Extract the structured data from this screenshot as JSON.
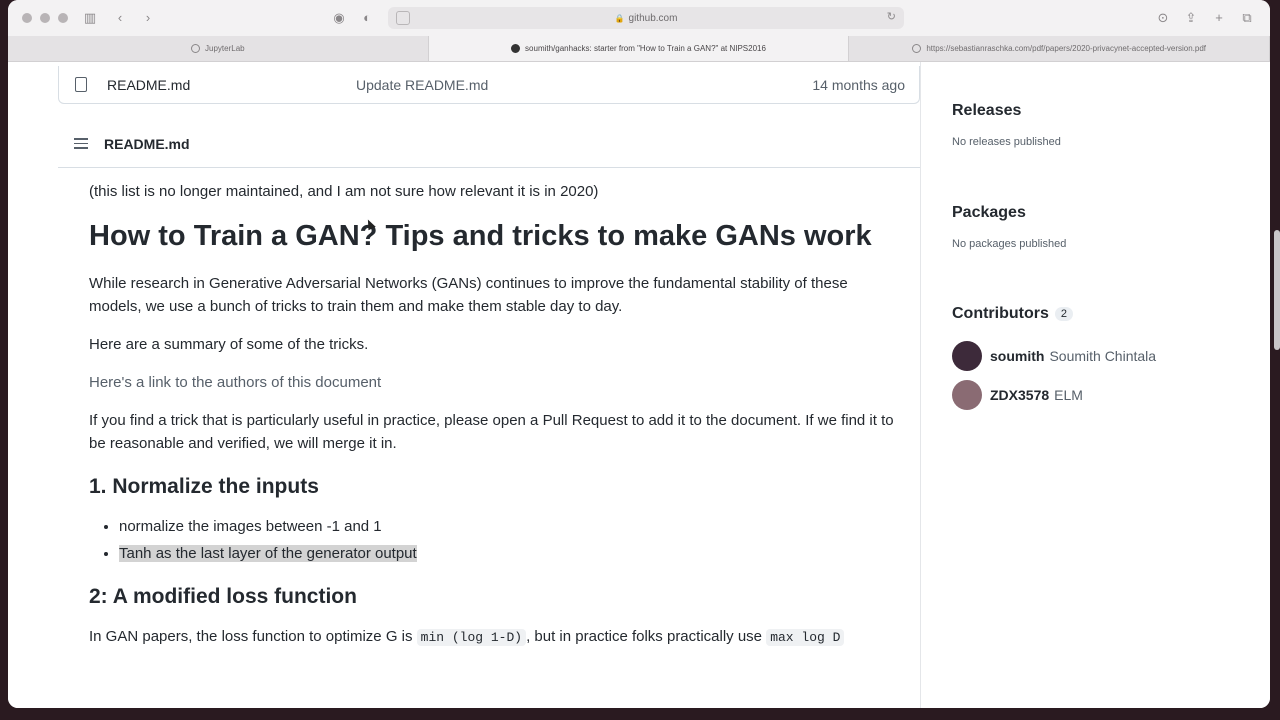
{
  "browser": {
    "url": "github.com",
    "tabs": [
      {
        "label": "JupyterLab"
      },
      {
        "label": "soumith/ganhacks: starter from \"How to Train a GAN?\" at NIPS2016"
      },
      {
        "label": "https://sebastianraschka.com/pdf/papers/2020-privacynet-accepted-version.pdf"
      }
    ]
  },
  "file_row": {
    "name": "README.md",
    "message": "Update README.md",
    "date": "14 months ago"
  },
  "readme": {
    "header": "README.md",
    "note": "(this list is no longer maintained, and I am not sure how relevant it is in 2020)",
    "title": "How to Train a GAN? Tips and tricks to make GANs work",
    "intro": "While research in Generative Adversarial Networks (GANs) continues to improve the fundamental stability of these models, we use a bunch of tricks to train them and make them stable day to day.",
    "summary": "Here are a summary of some of the tricks.",
    "authors_link": "Here's a link to the authors of this document",
    "contribute": "If you find a trick that is particularly useful in practice, please open a Pull Request to add it to the document. If we find it to be reasonable and verified, we will merge it in.",
    "section1_title": "1. Normalize the inputs",
    "section1_items": [
      "normalize the images between -1 and 1",
      "Tanh as the last layer of the generator output"
    ],
    "section2_title": "2: A modified loss function",
    "loss_text_a": "In GAN papers, the loss function to optimize G is ",
    "loss_code_a": "min (log 1-D)",
    "loss_text_b": ", but in practice folks practically use ",
    "loss_code_b": "max log D"
  },
  "sidebar": {
    "releases_title": "Releases",
    "releases_text": "No releases published",
    "packages_title": "Packages",
    "packages_text": "No packages published",
    "contributors_title": "Contributors",
    "contributors_count": "2",
    "contributors": [
      {
        "login": "soumith",
        "name": "Soumith Chintala"
      },
      {
        "login": "ZDX3578",
        "name": "ELM"
      }
    ]
  }
}
